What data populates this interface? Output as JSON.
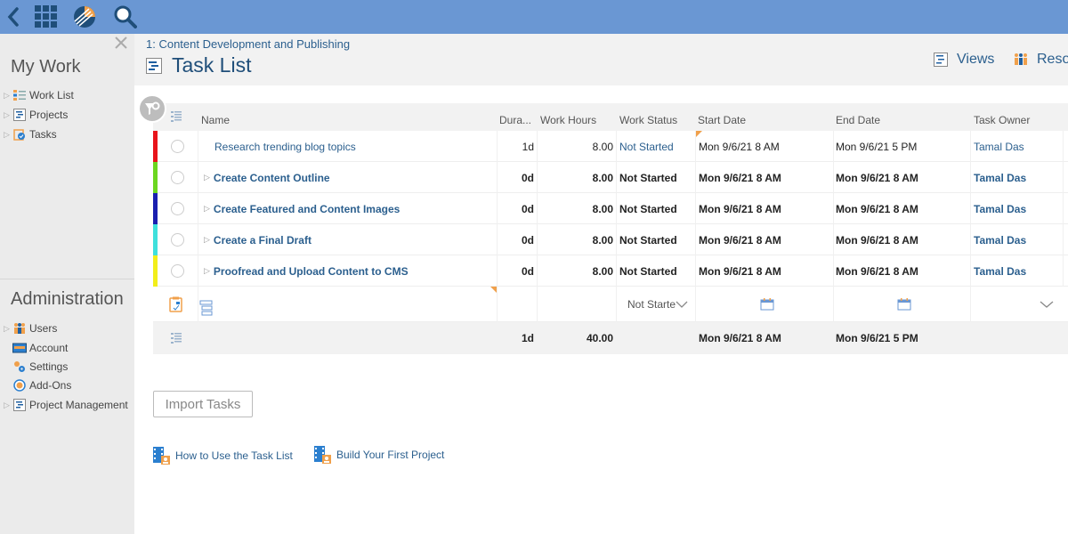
{
  "topbar": {
    "icons": [
      "back-icon",
      "app-grid-icon",
      "logo-icon",
      "search-icon"
    ]
  },
  "sidebar": {
    "my_work_title": "My Work",
    "my_work_items": [
      {
        "label": "Work List",
        "icon": "work-list-icon",
        "expandable": true
      },
      {
        "label": "Projects",
        "icon": "projects-icon",
        "expandable": true
      },
      {
        "label": "Tasks",
        "icon": "tasks-icon",
        "expandable": true
      }
    ],
    "admin_title": "Administration",
    "admin_items": [
      {
        "label": "Users",
        "icon": "users-icon",
        "expandable": true
      },
      {
        "label": "Account",
        "icon": "account-icon",
        "expandable": false
      },
      {
        "label": "Settings",
        "icon": "settings-icon",
        "expandable": false
      },
      {
        "label": "Add-Ons",
        "icon": "add-ons-icon",
        "expandable": false
      },
      {
        "label": "Project Management",
        "icon": "project-management-icon",
        "expandable": true
      }
    ]
  },
  "header": {
    "breadcrumb": "1: Content Development and Publishing",
    "title": "Task List",
    "views_label": "Views",
    "resources_label": "Reso"
  },
  "grid": {
    "columns": {
      "name": "Name",
      "duration": "Dura...",
      "work_hours": "Work Hours",
      "work_status": "Work Status",
      "start_date": "Start Date",
      "end_date": "End Date",
      "task_owner": "Task Owner"
    },
    "rows": [
      {
        "color": "#e8141b",
        "name": "Research trending blog topics",
        "summary": false,
        "duration": "1d",
        "work_hours": "8.00",
        "work_status": "Not Started",
        "start_date": "Mon 9/6/21 8 AM",
        "end_date": "Mon 9/6/21 5 PM",
        "owner": "Tamal Das"
      },
      {
        "color": "#6cd620",
        "name": "Create Content Outline",
        "summary": true,
        "duration": "0d",
        "work_hours": "8.00",
        "work_status": "Not Started",
        "start_date": "Mon 9/6/21 8 AM",
        "end_date": "Mon 9/6/21 8 AM",
        "owner": "Tamal Das"
      },
      {
        "color": "#1a1fb0",
        "name": "Create Featured and Content Images",
        "summary": true,
        "duration": "0d",
        "work_hours": "8.00",
        "work_status": "Not Started",
        "start_date": "Mon 9/6/21 8 AM",
        "end_date": "Mon 9/6/21 8 AM",
        "owner": "Tamal Das"
      },
      {
        "color": "#3ee0dc",
        "name": "Create a Final Draft",
        "summary": true,
        "duration": "0d",
        "work_hours": "8.00",
        "work_status": "Not Started",
        "start_date": "Mon 9/6/21 8 AM",
        "end_date": "Mon 9/6/21 8 AM",
        "owner": "Tamal Das"
      },
      {
        "color": "#f2ee1a",
        "name": "Proofread and Upload Content to CMS",
        "summary": true,
        "duration": "0d",
        "work_hours": "8.00",
        "work_status": "Not Started",
        "start_date": "Mon 9/6/21 8 AM",
        "end_date": "Mon 9/6/21 8 AM",
        "owner": "Tamal Das"
      }
    ],
    "new_row": {
      "work_status_value": "Not Starte"
    },
    "totals": {
      "duration": "1d",
      "work_hours": "40.00",
      "start_date": "Mon 9/6/21 8 AM",
      "end_date": "Mon 9/6/21 5 PM"
    }
  },
  "actions": {
    "import_label": "Import Tasks",
    "help_links": [
      "How to Use the Task List",
      "Build Your First Project"
    ]
  },
  "colors": {
    "topbar": "#6a97d3",
    "link": "#2b5f8e",
    "accent_orange": "#f0a04b"
  }
}
